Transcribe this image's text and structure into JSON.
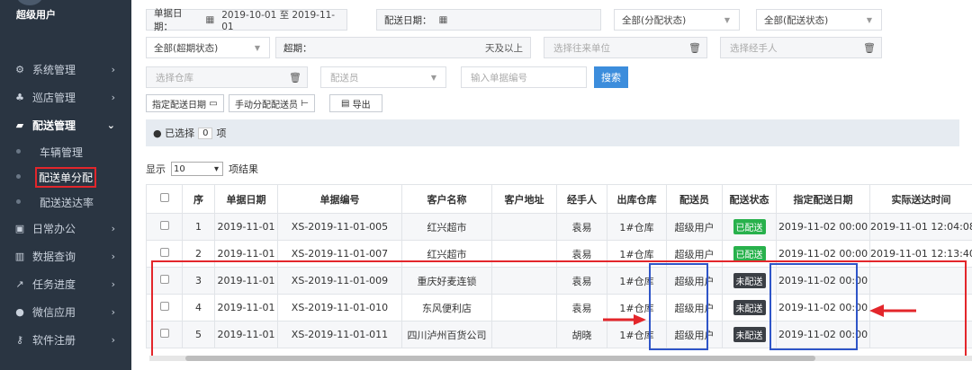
{
  "sidebar": {
    "user": "超级用户",
    "items": [
      {
        "icon": "gears-icon",
        "label": "系统管理"
      },
      {
        "icon": "sitemap-icon",
        "label": "巡店管理"
      },
      {
        "icon": "truck-icon",
        "label": "配送管理"
      },
      {
        "icon": "briefcase-icon",
        "label": "日常办公"
      },
      {
        "icon": "bar-chart-icon",
        "label": "数据查询"
      },
      {
        "icon": "line-chart-icon",
        "label": "任务进度"
      },
      {
        "icon": "wechat-icon",
        "label": "微信应用"
      },
      {
        "icon": "key-icon",
        "label": "软件注册"
      }
    ],
    "sub_items": [
      "车辆管理",
      "配送单分配",
      "配送送达率"
    ]
  },
  "filters": {
    "doc_date_label": "单据日期：",
    "doc_date_value": "2019-10-01 至 2019-11-01",
    "delivery_date_label": "配送日期：",
    "assign_status": "全部(分配状态)",
    "delivery_status": "全部(配送状态)",
    "overdue_status": "全部(超期状态)",
    "overdue_label": "超期：",
    "overdue_suffix": "天及以上",
    "partner_placeholder": "选择往来单位",
    "handler_placeholder": "选择经手人",
    "warehouse_placeholder": "选择仓库",
    "courier_placeholder": "配送员",
    "docno_placeholder": "输入单据编号",
    "search_label": "搜索"
  },
  "toolbar": {
    "assign_date_label": "指定配送日期",
    "manual_assign_label": "手动分配配送员",
    "export_label": "导出"
  },
  "selection": {
    "prefix": "已选择",
    "count": "0",
    "suffix": "项"
  },
  "pager": {
    "show": "显示",
    "page_size": "10",
    "suffix": "项结果"
  },
  "table": {
    "headers": [
      "",
      "序",
      "单据日期",
      "单据编号",
      "客户名称",
      "客户地址",
      "经手人",
      "出库仓库",
      "配送员",
      "配送状态",
      "指定配送日期",
      "实际送达时间"
    ],
    "rows": [
      {
        "no": "1",
        "date": "2019-11-01",
        "docno": "XS-2019-11-01-005",
        "customer": "红兴超市",
        "address": "",
        "handler": "袁易",
        "warehouse": "1#仓库",
        "courier": "超级用户",
        "status": "已配送",
        "status_color": "#28b14c",
        "assign_date": "2019-11-02 00:00",
        "arrive_time": "2019-11-01 12:04:08"
      },
      {
        "no": "2",
        "date": "2019-11-01",
        "docno": "XS-2019-11-01-007",
        "customer": "红兴超市",
        "address": "",
        "handler": "袁易",
        "warehouse": "1#仓库",
        "courier": "超级用户",
        "status": "已配送",
        "status_color": "#28b14c",
        "assign_date": "2019-11-02 00:00",
        "arrive_time": "2019-11-01 12:13:40"
      },
      {
        "no": "3",
        "date": "2019-11-01",
        "docno": "XS-2019-11-01-009",
        "customer": "重庆好麦连锁",
        "address": "",
        "handler": "袁易",
        "warehouse": "1#仓库",
        "courier": "超级用户",
        "status": "未配送",
        "status_color": "#3b3f45",
        "assign_date": "2019-11-02 00:00",
        "arrive_time": ""
      },
      {
        "no": "4",
        "date": "2019-11-01",
        "docno": "XS-2019-11-01-010",
        "customer": "东风便利店",
        "address": "",
        "handler": "袁易",
        "warehouse": "1#仓库",
        "courier": "超级用户",
        "status": "未配送",
        "status_color": "#3b3f45",
        "assign_date": "2019-11-02 00:00",
        "arrive_time": ""
      },
      {
        "no": "5",
        "date": "2019-11-01",
        "docno": "XS-2019-11-01-011",
        "customer": "四川泸州百货公司",
        "address": "",
        "handler": "胡晓",
        "warehouse": "1#仓库",
        "courier": "超级用户",
        "status": "未配送",
        "status_color": "#3b3f45",
        "assign_date": "2019-11-02 00:00",
        "arrive_time": ""
      }
    ]
  },
  "colors": {
    "sidebar_bg": "#2a3542",
    "accent": "#3c8ddc",
    "highlight_red": "#e3262b",
    "highlight_blue": "#2f55c8"
  }
}
